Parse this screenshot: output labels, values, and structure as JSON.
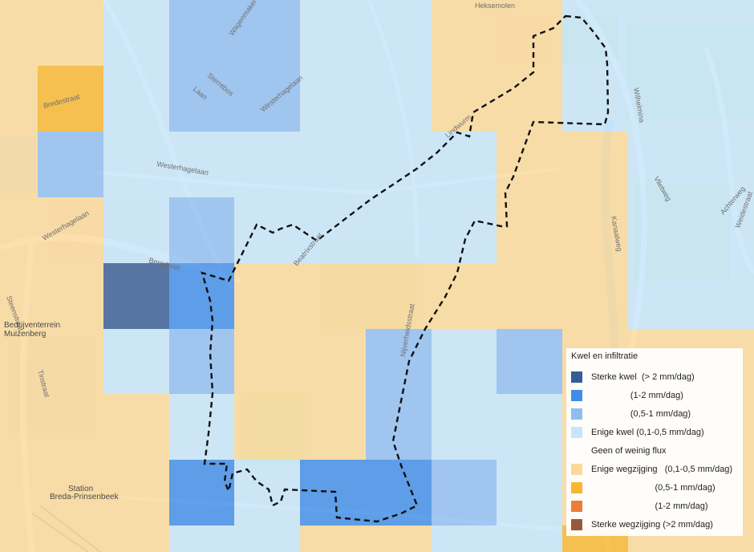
{
  "colors": {
    "base": "#eeeae3",
    "strong_seepage": "#355c96",
    "seepage_1_2": "#3f8de8",
    "seepage_05_1": "#8fbdf2",
    "some_seepage": "#c6e6fb",
    "no_flux": "#ffffff",
    "some_infiltration": "#fbd99a",
    "infiltration_05_1": "#f7b731",
    "infiltration_1_2": "#ec7d34",
    "strong_infiltration": "#98593a",
    "boundary": "#111111"
  },
  "map": {
    "street_labels": [
      "Heksemolen",
      "Wagenmaker",
      "Sterrebos",
      "Laan",
      "Westerhagelaan",
      "Westerhagelaan",
      "Bredestraat",
      "Bergdreef",
      "Westerhagelaan",
      "Steenstraat",
      "Lindwurm",
      "Beatrixstraat",
      "Nijverheidsstraat",
      "Tinstraat",
      "Wilhelmina",
      "Vlietweg",
      "Achterweg",
      "Weidestraat",
      "Kanaalweg"
    ],
    "place_labels": [
      "Bedrijventerrein",
      "Muizenberg",
      "Station",
      "Breda-Prinsenbeek"
    ]
  },
  "legend": {
    "title": "Kwel en infiltratie",
    "items": [
      {
        "color": "#355c96",
        "label": "Sterke kwel  (> 2 mm/dag)"
      },
      {
        "color": "#3f8de8",
        "label": "                (1-2 mm/dag)"
      },
      {
        "color": "#8fbdf2",
        "label": "                (0,5-1 mm/dag)"
      },
      {
        "color": "#c6e6fb",
        "label": "Enige kwel (0,1-0,5 mm/dag)"
      },
      {
        "color": "",
        "label": "Geen of weinig flux"
      },
      {
        "color": "#fbd99a",
        "label": "Enige wegzijging   (0,1-0,5 mm/dag)"
      },
      {
        "color": "#f7b731",
        "label": "                          (0,5-1 mm/dag)"
      },
      {
        "color": "#ec7d34",
        "label": "                          (1-2 mm/dag)"
      },
      {
        "color": "#98593a",
        "label": "Sterke wegzijging (>2 mm/dag)"
      }
    ]
  }
}
